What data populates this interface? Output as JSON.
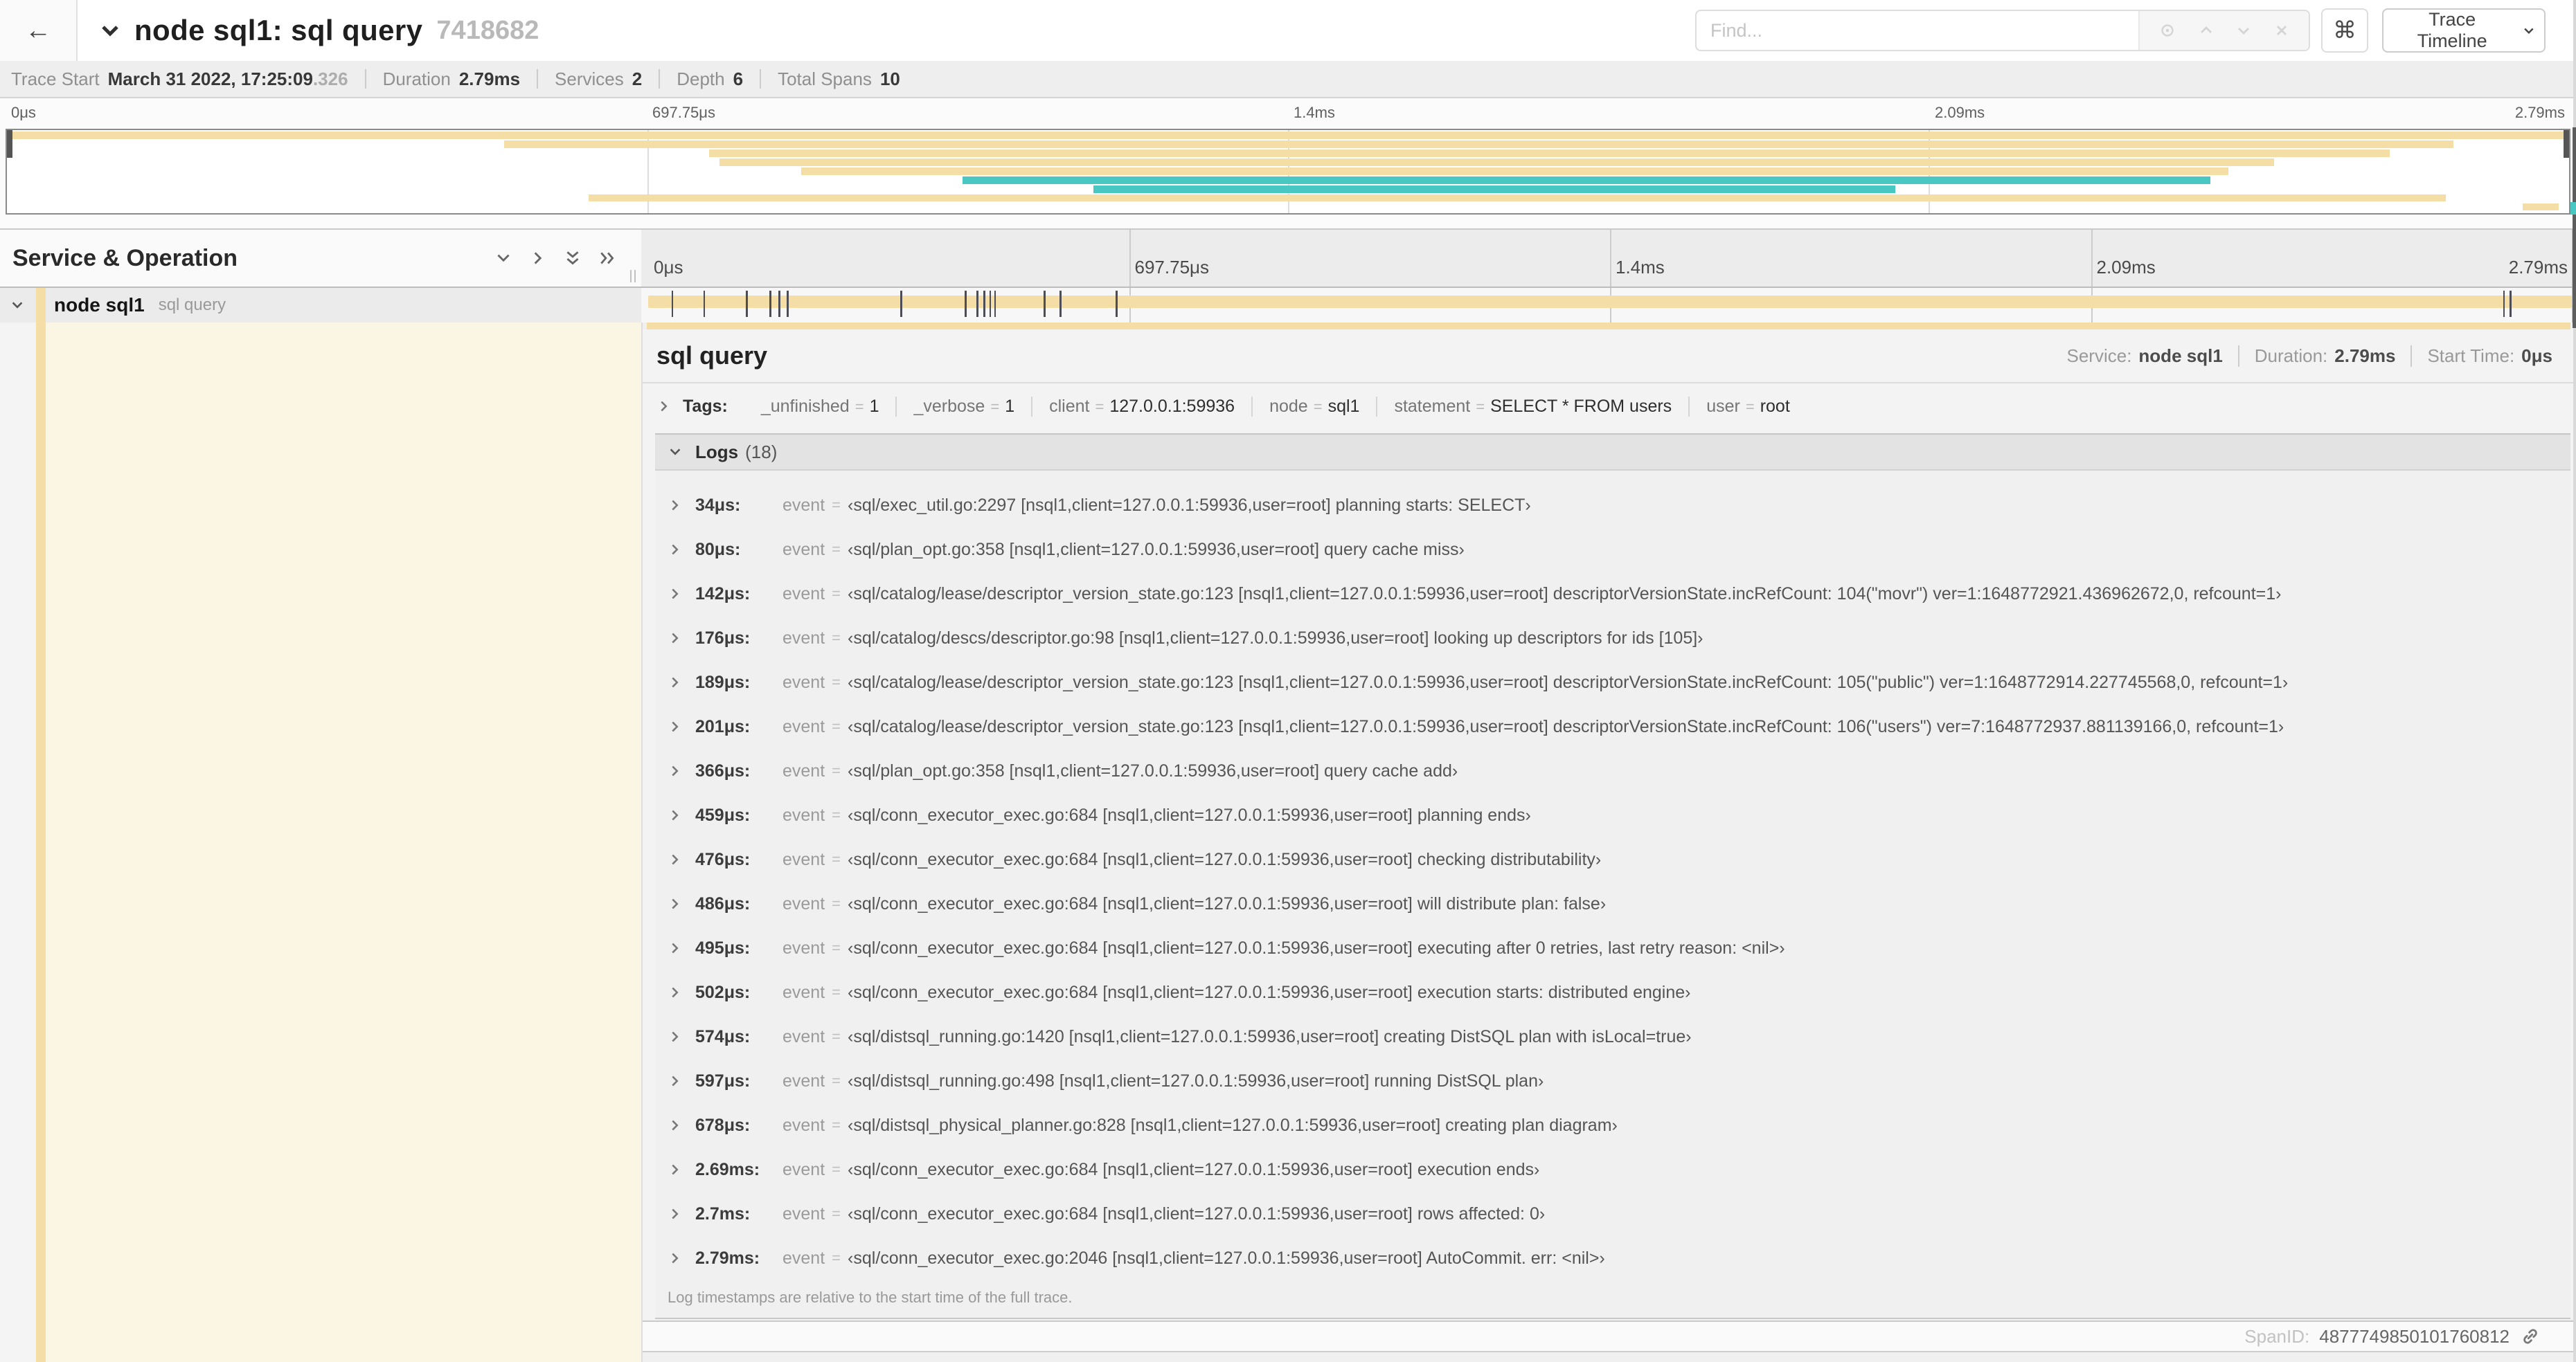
{
  "header": {
    "back_icon": "←",
    "title": "node sql1: sql query",
    "trace_id": "7418682",
    "find_placeholder": "Find...",
    "shortcut_button": "⌘",
    "view_selector": "Trace Timeline"
  },
  "summary": {
    "items": [
      {
        "label": "Trace Start",
        "value": "March 31 2022, 17:25:09",
        "suffix": ".326"
      },
      {
        "label": "Duration",
        "value": "2.79ms"
      },
      {
        "label": "Services",
        "value": "2"
      },
      {
        "label": "Depth",
        "value": "6"
      },
      {
        "label": "Total Spans",
        "value": "10"
      }
    ]
  },
  "minimap": {
    "ticks": [
      {
        "label": "0μs",
        "pct": 0
      },
      {
        "label": "697.75μs",
        "pct": 25
      },
      {
        "label": "1.4ms",
        "pct": 50
      },
      {
        "label": "2.09ms",
        "pct": 75
      },
      {
        "label": "2.79ms",
        "pct": 100
      }
    ],
    "spans": [
      {
        "start": 0,
        "end": 100,
        "color": "tan"
      },
      {
        "start": 19.4,
        "end": 95.5,
        "color": "tan"
      },
      {
        "start": 27.4,
        "end": 93,
        "color": "tan"
      },
      {
        "start": 27.8,
        "end": 88.5,
        "color": "tan"
      },
      {
        "start": 31,
        "end": 86.7,
        "color": "tan"
      },
      {
        "start": 37.3,
        "end": 86,
        "color": "teal"
      },
      {
        "start": 42.4,
        "end": 73.7,
        "color": "teal"
      },
      {
        "start": 22.7,
        "end": 95.2,
        "color": "tan"
      },
      {
        "start": 98.2,
        "end": 99.6,
        "color": "tan"
      }
    ]
  },
  "timeline": {
    "left_header": "Service & Operation",
    "ticks": [
      {
        "label": "0μs",
        "pct": 0
      },
      {
        "label": "697.75μs",
        "pct": 25
      },
      {
        "label": "1.4ms",
        "pct": 50
      },
      {
        "label": "2.09ms",
        "pct": 75
      },
      {
        "label": "2.79ms",
        "pct": 100
      }
    ],
    "row": {
      "service": "node sql1",
      "operation": "sql query",
      "bar_start_pct": 0,
      "bar_end_pct": 100,
      "bar_color": "tan",
      "log_marker_pcts": [
        1.22,
        2.87,
        5.09,
        6.31,
        6.77,
        7.2,
        13.12,
        16.45,
        17.06,
        17.42,
        17.74,
        17.99,
        20.57,
        21.4,
        24.3,
        96.42,
        96.77
      ]
    }
  },
  "detail": {
    "title": "sql query",
    "meta": [
      {
        "label": "Service:",
        "value": "node sql1"
      },
      {
        "label": "Duration:",
        "value": "2.79ms"
      },
      {
        "label": "Start Time:",
        "value": "0μs"
      }
    ],
    "tags_label": "Tags:",
    "tags": [
      {
        "key": "_unfinished",
        "value": "1"
      },
      {
        "key": "_verbose",
        "value": "1"
      },
      {
        "key": "client",
        "value": "127.0.0.1:59936"
      },
      {
        "key": "node",
        "value": "sql1"
      },
      {
        "key": "statement",
        "value": "SELECT * FROM users"
      },
      {
        "key": "user",
        "value": "root"
      }
    ],
    "logs_label": "Logs",
    "logs_count": "(18)",
    "logs": [
      {
        "ts": "34μs:",
        "field": "event",
        "value": "‹sql/exec_util.go:2297 [nsql1,client=127.0.0.1:59936,user=root] planning starts: SELECT›"
      },
      {
        "ts": "80μs:",
        "field": "event",
        "value": "‹sql/plan_opt.go:358 [nsql1,client=127.0.0.1:59936,user=root] query cache miss›"
      },
      {
        "ts": "142μs:",
        "field": "event",
        "value": "‹sql/catalog/lease/descriptor_version_state.go:123 [nsql1,client=127.0.0.1:59936,user=root] descriptorVersionState.incRefCount: 104(\"movr\") ver=1:1648772921.436962672,0, refcount=1›"
      },
      {
        "ts": "176μs:",
        "field": "event",
        "value": "‹sql/catalog/descs/descriptor.go:98 [nsql1,client=127.0.0.1:59936,user=root] looking up descriptors for ids [105]›"
      },
      {
        "ts": "189μs:",
        "field": "event",
        "value": "‹sql/catalog/lease/descriptor_version_state.go:123 [nsql1,client=127.0.0.1:59936,user=root] descriptorVersionState.incRefCount: 105(\"public\") ver=1:1648772914.227745568,0, refcount=1›"
      },
      {
        "ts": "201μs:",
        "field": "event",
        "value": "‹sql/catalog/lease/descriptor_version_state.go:123 [nsql1,client=127.0.0.1:59936,user=root] descriptorVersionState.incRefCount: 106(\"users\") ver=7:1648772937.881139166,0, refcount=1›"
      },
      {
        "ts": "366μs:",
        "field": "event",
        "value": "‹sql/plan_opt.go:358 [nsql1,client=127.0.0.1:59936,user=root] query cache add›"
      },
      {
        "ts": "459μs:",
        "field": "event",
        "value": "‹sql/conn_executor_exec.go:684 [nsql1,client=127.0.0.1:59936,user=root] planning ends›"
      },
      {
        "ts": "476μs:",
        "field": "event",
        "value": "‹sql/conn_executor_exec.go:684 [nsql1,client=127.0.0.1:59936,user=root] checking distributability›"
      },
      {
        "ts": "486μs:",
        "field": "event",
        "value": "‹sql/conn_executor_exec.go:684 [nsql1,client=127.0.0.1:59936,user=root] will distribute plan: false›"
      },
      {
        "ts": "495μs:",
        "field": "event",
        "value": "‹sql/conn_executor_exec.go:684 [nsql1,client=127.0.0.1:59936,user=root] executing after 0 retries, last retry reason: <nil>›"
      },
      {
        "ts": "502μs:",
        "field": "event",
        "value": "‹sql/conn_executor_exec.go:684 [nsql1,client=127.0.0.1:59936,user=root] execution starts: distributed engine›"
      },
      {
        "ts": "574μs:",
        "field": "event",
        "value": "‹sql/distsql_running.go:1420 [nsql1,client=127.0.0.1:59936,user=root] creating DistSQL plan with isLocal=true›"
      },
      {
        "ts": "597μs:",
        "field": "event",
        "value": "‹sql/distsql_running.go:498 [nsql1,client=127.0.0.1:59936,user=root] running DistSQL plan›"
      },
      {
        "ts": "678μs:",
        "field": "event",
        "value": "‹sql/distsql_physical_planner.go:828 [nsql1,client=127.0.0.1:59936,user=root] creating plan diagram›"
      },
      {
        "ts": "2.69ms:",
        "field": "event",
        "value": "‹sql/conn_executor_exec.go:684 [nsql1,client=127.0.0.1:59936,user=root] execution ends›"
      },
      {
        "ts": "2.7ms:",
        "field": "event",
        "value": "‹sql/conn_executor_exec.go:684 [nsql1,client=127.0.0.1:59936,user=root] rows affected: 0›"
      },
      {
        "ts": "2.79ms:",
        "field": "event",
        "value": "‹sql/conn_executor_exec.go:2046 [nsql1,client=127.0.0.1:59936,user=root] AutoCommit. err: <nil>›"
      }
    ],
    "logs_footer": "Log timestamps are relative to the start time of the full trace.",
    "span_id_label": "SpanID:",
    "span_id": "4877749850101760812"
  },
  "colors": {
    "tan": "#F5DDA6",
    "teal": "#48C7C3"
  }
}
